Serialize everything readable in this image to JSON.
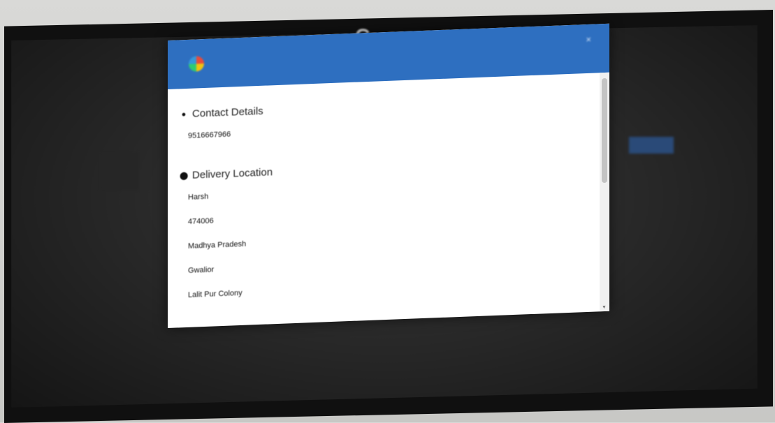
{
  "background": {
    "logo_letter": "C"
  },
  "modal": {
    "header_color": "#2e6fc0",
    "close_label": "×",
    "contact": {
      "title": "Contact Details",
      "phone_value": "9516667966"
    },
    "delivery": {
      "title": "Delivery Location",
      "fields": [
        {
          "value": "Harsh"
        },
        {
          "value": "474006"
        },
        {
          "value": "Madhya Pradesh"
        },
        {
          "value": "Gwalior"
        },
        {
          "value": "Lalit Pur Colony"
        }
      ]
    }
  }
}
